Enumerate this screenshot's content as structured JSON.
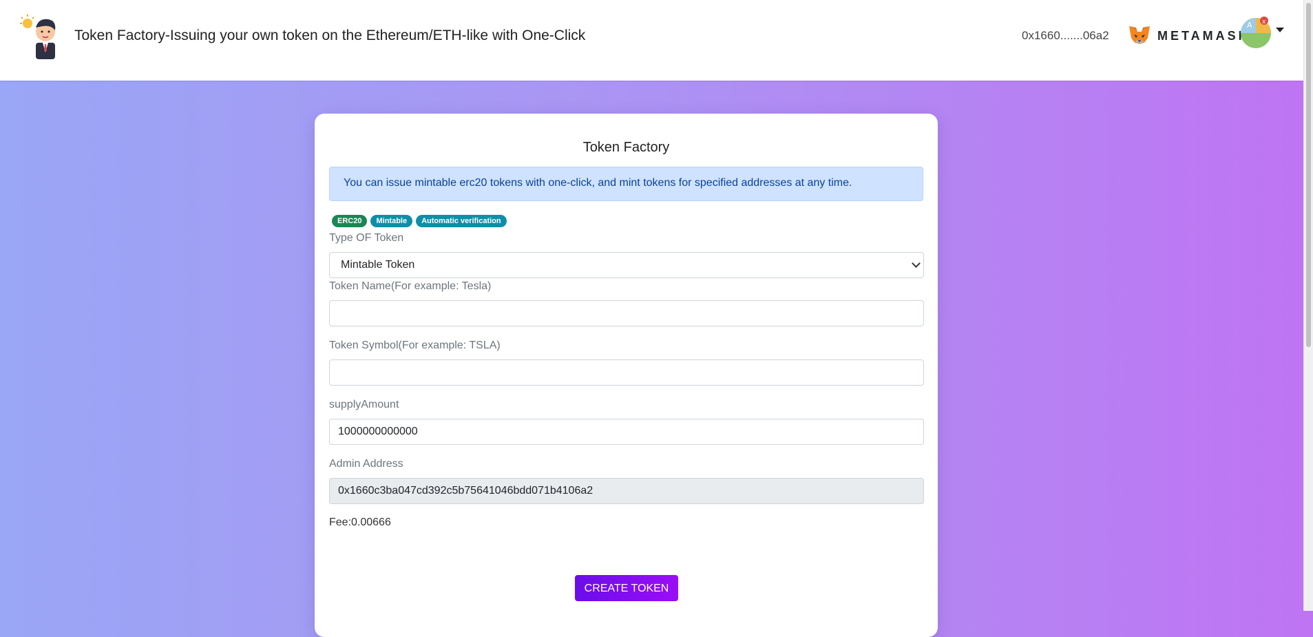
{
  "header": {
    "title": "Token Factory-Issuing your own token on the Ethereum/ETH-like with One-Click",
    "address": "0x1660.......06a2",
    "wallet_name": "METAMASK"
  },
  "card": {
    "title": "Token Factory",
    "alert": "You can issue mintable erc20 tokens with one-click, and mint tokens for specified addresses at any time.",
    "badges": [
      "ERC20",
      "Mintable",
      "Automatic verification"
    ],
    "type_label": "Type OF Token",
    "type_selected": "Mintable Token",
    "name_label": "Token Name(For example: Tesla)",
    "name_value": "",
    "symbol_label": "Token Symbol(For example: TSLA)",
    "symbol_value": "",
    "supply_label": "supplyAmount",
    "supply_value": "1000000000000",
    "admin_label": "Admin Address",
    "admin_value": "0x1660c3ba047cd392c5b75641046bdd071b4106a2",
    "fee": "Fee:0.00666",
    "create_button": "CREATE TOKEN"
  },
  "colors": {
    "accent": "#7a0df0",
    "badge_green": "#198754",
    "badge_teal": "#0d8fa8",
    "alert_bg": "#cfe2ff"
  }
}
